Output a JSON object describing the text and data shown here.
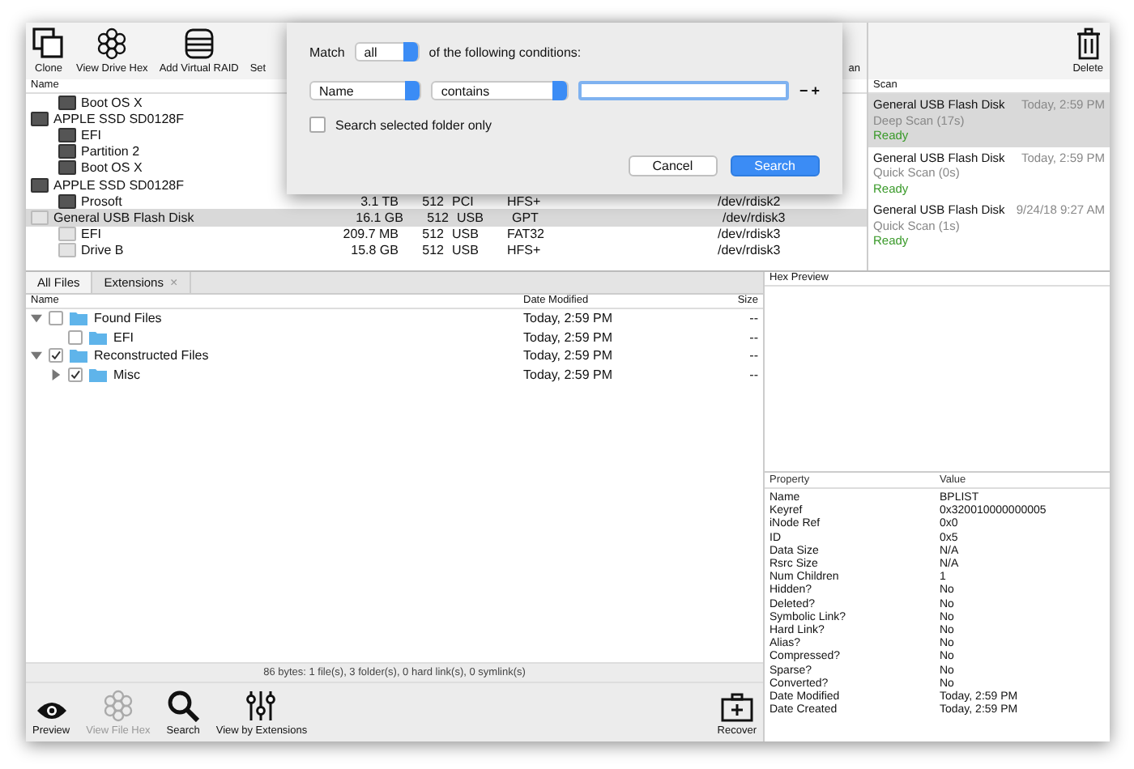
{
  "toolbar": {
    "left": [
      {
        "label": "Clone",
        "kind": "clone"
      },
      {
        "label": "View Drive Hex",
        "kind": "hex"
      },
      {
        "label": "Add Virtual RAID",
        "kind": "raid"
      },
      {
        "label": "Set"
      }
    ],
    "middle": [
      {
        "label": "an"
      }
    ],
    "right": [
      {
        "label": "Delete",
        "kind": "trash"
      }
    ]
  },
  "drive_table": {
    "columns": [
      "Name"
    ],
    "rows": [
      {
        "name": "Boot OS X",
        "kind": "internal-volume",
        "selected": false
      },
      {
        "name": "APPLE SSD SD0128F",
        "kind": "internal-disk",
        "selected": false,
        "children": [
          {
            "name": "EFI",
            "kind": "internal-volume",
            "selected": false
          },
          {
            "name": "Partition 2",
            "kind": "internal-volume",
            "selected": false
          },
          {
            "name": "Boot OS X",
            "kind": "internal-volume",
            "selected": false
          }
        ]
      },
      {
        "name": "APPLE SSD SD0128F",
        "kind": "internal-disk",
        "selected": false,
        "children": [
          {
            "name": "Prosoft",
            "kind": "internal-volume",
            "selected": false,
            "size": "3.1 TB",
            "block": "512",
            "bus": "PCI",
            "format": "HFS+",
            "device": "/dev/rdisk2"
          }
        ]
      },
      {
        "name": "General USB Flash Disk",
        "kind": "usb-disk",
        "selected": true,
        "size": "16.1 GB",
        "block": "512",
        "bus": "USB",
        "format": "GPT",
        "device": "/dev/rdisk3",
        "children": [
          {
            "name": "EFI",
            "kind": "usb-volume",
            "selected": false,
            "size": "209.7 MB",
            "block": "512",
            "bus": "USB",
            "format": "FAT32",
            "device": "/dev/rdisk3"
          },
          {
            "name": "Drive B",
            "kind": "usb-volume",
            "selected": false,
            "size": "15.8 GB",
            "block": "512",
            "bus": "USB",
            "format": "HFS+",
            "device": "/dev/rdisk3"
          }
        ]
      }
    ]
  },
  "scan_panel": {
    "header": "Scan",
    "items": [
      {
        "name": "General USB Flash Disk",
        "time": "Today, 2:59 PM",
        "type": "Deep Scan (17s)",
        "status": "Ready",
        "selected": true
      },
      {
        "name": "General USB Flash Disk",
        "time": "Today, 2:59 PM",
        "type": "Quick Scan (0s)",
        "status": "Ready",
        "selected": false
      },
      {
        "name": "General USB Flash Disk",
        "time": "9/24/18 9:27 AM",
        "type": "Quick Scan (1s)",
        "status": "Ready",
        "selected": false
      }
    ]
  },
  "dialog": {
    "match_label": "Match",
    "match_value": "all",
    "match_suffix": "of the following conditions:",
    "field": "Name",
    "operator": "contains",
    "remove": "−",
    "add": "+",
    "checkbox": {
      "label": "Search selected folder only",
      "checked": false
    },
    "buttons": [
      {
        "label": "Cancel",
        "default": false
      },
      {
        "label": "Search",
        "default": true
      }
    ]
  },
  "file_browser": {
    "tabs": [
      {
        "label": "All Files",
        "selected": true
      },
      {
        "label": "Extensions",
        "selected": false,
        "close": "×"
      }
    ],
    "columns": [
      "Name",
      "Date Modified",
      "Size"
    ],
    "tree": [
      {
        "name": "Found Files",
        "date": "Today, 2:59 PM",
        "size": "--",
        "checked": false,
        "expanded": true,
        "children": [
          {
            "name": "EFI",
            "date": "Today, 2:59 PM",
            "size": "--",
            "checked": false
          }
        ]
      },
      {
        "name": "Reconstructed Files",
        "date": "Today, 2:59 PM",
        "size": "--",
        "checked": true,
        "expanded": true,
        "children": [
          {
            "name": "Misc",
            "date": "Today, 2:59 PM",
            "size": "--",
            "checked": true,
            "expanded": false
          }
        ]
      }
    ],
    "status": "86 bytes: 1 file(s), 3 folder(s), 0 hard link(s), 0 symlink(s)"
  },
  "bottom_toolbar": {
    "left": [
      {
        "label": "Preview",
        "kind": "eye",
        "disabled": false
      },
      {
        "label": "View File Hex",
        "kind": "hex",
        "disabled": true
      },
      {
        "label": "Search",
        "kind": "search",
        "disabled": false
      },
      {
        "label": "View by Extensions",
        "kind": "sliders",
        "disabled": false
      }
    ],
    "right": [
      {
        "label": "Recover",
        "kind": "kit",
        "disabled": false
      }
    ]
  },
  "hex_preview": {
    "title": "Hex Preview"
  },
  "properties": {
    "columns": [
      "Property",
      "Value"
    ],
    "rows": [
      [
        "Name",
        "BPLIST"
      ],
      [
        "Keyref",
        "0x320010000000005"
      ],
      [
        "iNode Ref",
        "0x0"
      ],
      [
        "ID",
        "0x5"
      ],
      [
        "Data Size",
        "N/A"
      ],
      [
        "Rsrc Size",
        "N/A"
      ],
      [
        "Num Children",
        "1"
      ],
      [
        "Hidden?",
        "No"
      ],
      [
        "Deleted?",
        "No"
      ],
      [
        "Symbolic Link?",
        "No"
      ],
      [
        "Hard Link?",
        "No"
      ],
      [
        "Alias?",
        "No"
      ],
      [
        "Compressed?",
        "No"
      ],
      [
        "Sparse?",
        "No"
      ],
      [
        "Converted?",
        "No"
      ],
      [
        "Date Modified",
        "Today, 2:59 PM"
      ],
      [
        "Date Created",
        "Today, 2:59 PM"
      ]
    ]
  }
}
